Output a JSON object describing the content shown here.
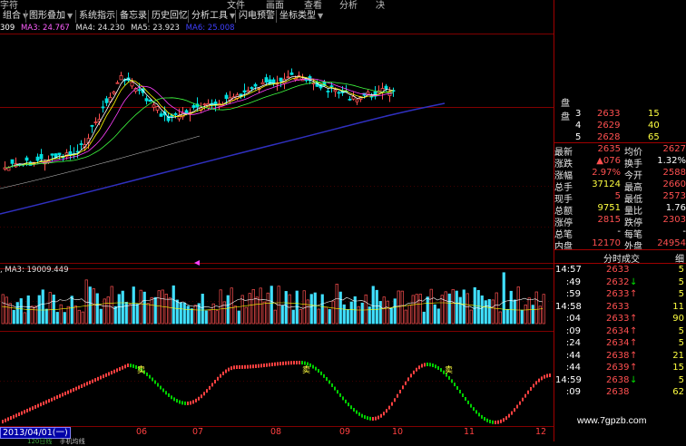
{
  "menu": {
    "items": [
      "文件",
      "画面",
      "查看",
      "分析",
      "决"
    ],
    "left_text": "字符"
  },
  "toolbar": {
    "buttons": [
      "组合",
      "图形叠加",
      "系统指示",
      "备忘录",
      "历史回忆",
      "分析工具",
      "闪电预警",
      "坐标类型"
    ]
  },
  "ma_line": {
    "prefix": "309",
    "ma3": "MA3: 24.767",
    "ma4": "MA4: 24.230",
    "ma5": "MA5: 23.923",
    "ma6": "MA6: 25.008"
  },
  "volume_line": {
    "prefix": ", MA3: 19009.449"
  },
  "quote": {
    "order_rows": [
      {
        "label": "盘",
        "n": "3",
        "price": "2633",
        "vol": "15"
      },
      {
        "label": "",
        "n": "4",
        "price": "2629",
        "vol": "40"
      },
      {
        "label": "",
        "n": "5",
        "price": "2628",
        "vol": "65"
      }
    ],
    "stats": [
      {
        "l1": "最新",
        "v1": "2635",
        "l2": "均价",
        "v2": "2627"
      },
      {
        "l1": "涨跌",
        "v1": "▲076",
        "l2": "换手",
        "v2": "1.32%"
      },
      {
        "l1": "涨幅",
        "v1": "2.97%",
        "l2": "今开",
        "v2": "2588"
      },
      {
        "l1": "总手",
        "v1": "37124",
        "l2": "最高",
        "v2": "2660"
      },
      {
        "l1": "现手",
        "v1": "5",
        "l2": "最低",
        "v2": "2573"
      },
      {
        "l1": "总额",
        "v1": "9751",
        "l2": "量比",
        "v2": "1.76"
      },
      {
        "l1": "涨停",
        "v1": "2815",
        "l2": "跌停",
        "v2": "2303"
      },
      {
        "l1": "总笔",
        "v1": "-",
        "l2": "每笔",
        "v2": "-"
      },
      {
        "l1": "内盘",
        "v1": "12170",
        "l2": "外盘",
        "v2": "24954"
      }
    ],
    "trades_header": "分时成交",
    "trades_header2": "细",
    "trades": [
      {
        "time": "14:57",
        "price": "2633",
        "arrow": "",
        "vol": "5"
      },
      {
        "time": ":49",
        "price": "2632",
        "arrow": "↓",
        "vol": "5"
      },
      {
        "time": ":59",
        "price": "2633",
        "arrow": "↑",
        "vol": "5"
      },
      {
        "time": "14:58",
        "price": "2633",
        "arrow": "",
        "vol": "11"
      },
      {
        "time": ":04",
        "price": "2633",
        "arrow": "↑",
        "vol": "90"
      },
      {
        "time": ":09",
        "price": "2634",
        "arrow": "↑",
        "vol": "5"
      },
      {
        "time": ":24",
        "price": "2634",
        "arrow": "↑",
        "vol": "5"
      },
      {
        "time": ":44",
        "price": "2638",
        "arrow": "↑",
        "vol": "21"
      },
      {
        "time": ":44",
        "price": "2639",
        "arrow": "↑",
        "vol": "15"
      },
      {
        "time": "14:59",
        "price": "2638",
        "arrow": "↓",
        "vol": "5"
      },
      {
        "time": ":09",
        "price": "2638",
        "arrow": "",
        "vol": "62"
      },
      {
        "time": "",
        "price": "",
        "arrow": "",
        "vol": ""
      }
    ]
  },
  "osc_labels": [
    "卖",
    "卖",
    "卖"
  ],
  "date_bar": {
    "current": "2013/04/01(一)",
    "months": [
      "06",
      "07",
      "08",
      "09",
      "10",
      "11",
      "12"
    ]
  },
  "bottom_tabs": [
    "120日线",
    "手机均线"
  ],
  "watermark": "www.7gpzb.com",
  "colors": {
    "up": "#ff5050",
    "down": "#00e0e0",
    "osc_up": "#ff4040",
    "osc_down": "#00d000",
    "ma_slow": "#3030c0"
  }
}
